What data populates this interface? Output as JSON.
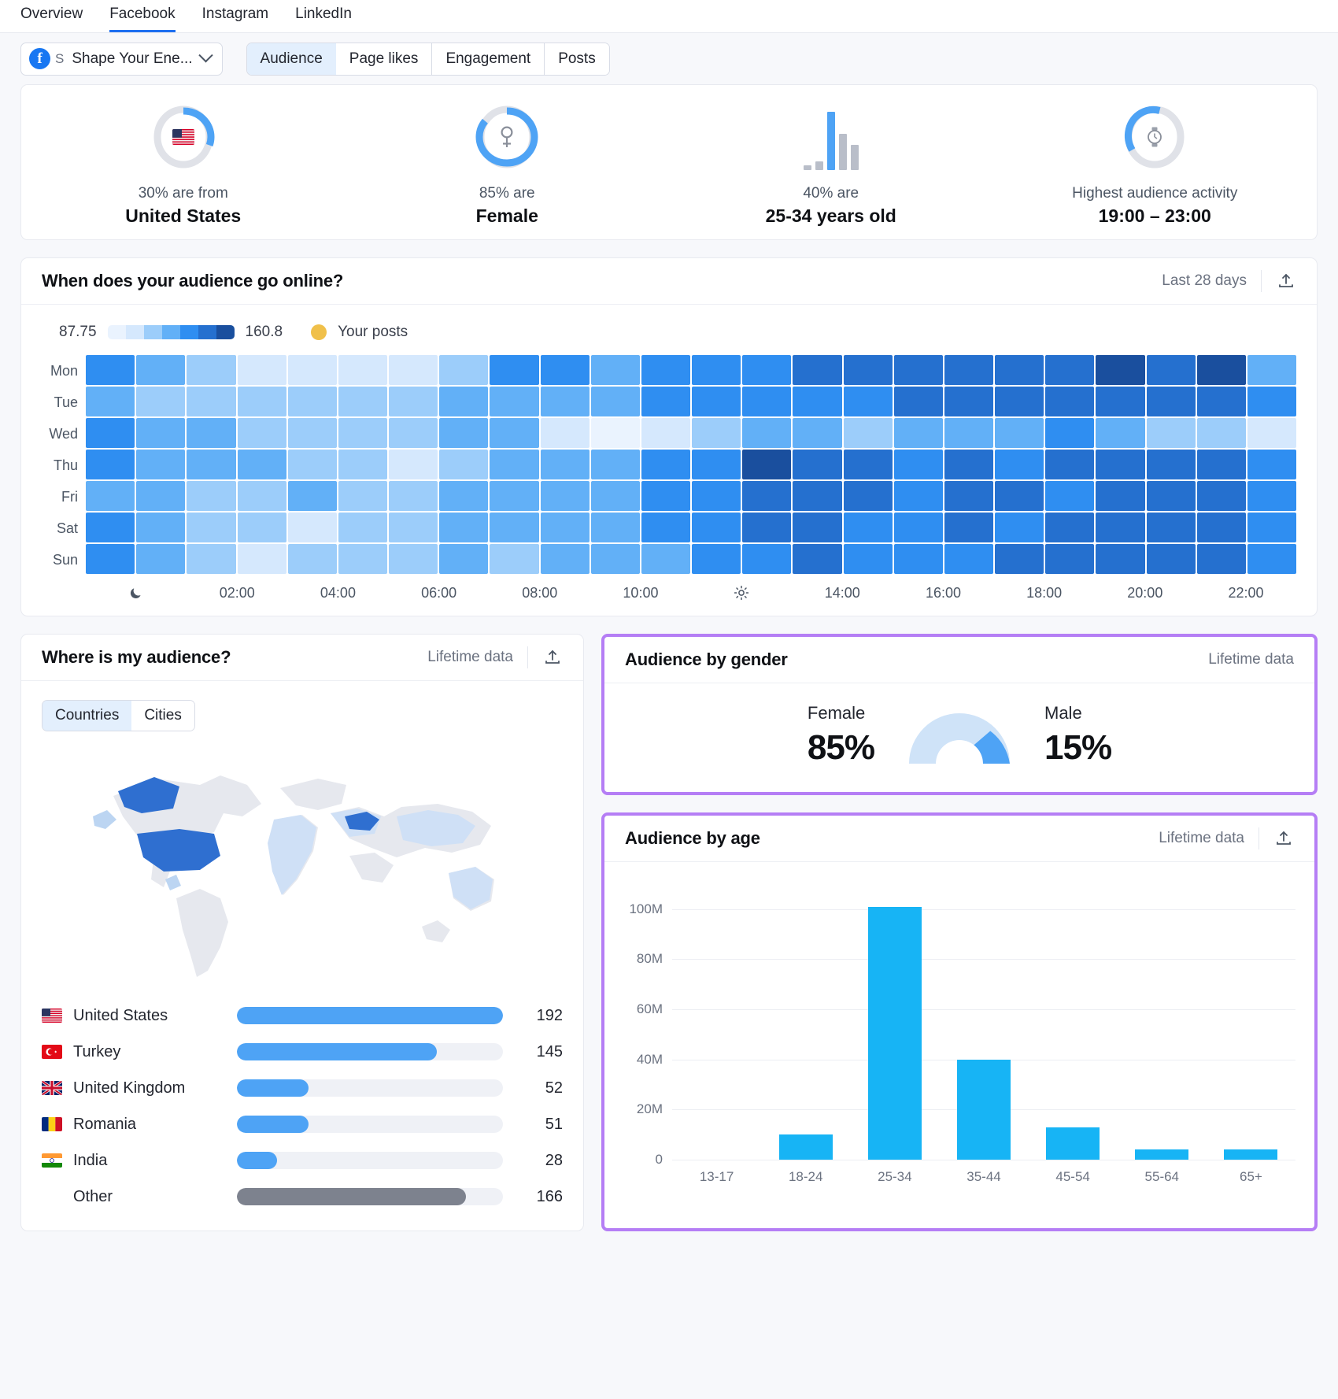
{
  "topnav": {
    "items": [
      {
        "label": "Overview",
        "active": false
      },
      {
        "label": "Facebook",
        "active": true
      },
      {
        "label": "Instagram",
        "active": false
      },
      {
        "label": "LinkedIn",
        "active": false
      }
    ]
  },
  "controlbar": {
    "account": {
      "badge": "f",
      "sub": "S",
      "name": "Shape Your Ene...",
      "chevron": "chevron-down-icon"
    },
    "tabs": [
      {
        "label": "Audience",
        "active": true
      },
      {
        "label": "Page likes",
        "active": false
      },
      {
        "label": "Engagement",
        "active": false
      },
      {
        "label": "Posts",
        "active": false
      }
    ]
  },
  "kpis": [
    {
      "sub": "30% are from",
      "main": "United States",
      "ring_pct": 30,
      "icon": "us-flag-icon"
    },
    {
      "sub": "85% are",
      "main": "Female",
      "ring_pct": 85,
      "icon": "female-symbol-icon"
    },
    {
      "sub": "40% are",
      "main": "25-34 years old",
      "icon": "bar-chart-icon",
      "mini_bars": [
        6,
        11,
        74,
        46,
        32
      ],
      "mini_highlight": 2
    },
    {
      "sub": "Highest audience activity",
      "main": "19:00 – 23:00",
      "ring_pct": 36,
      "icon": "clock-icon"
    }
  ],
  "heatmap": {
    "title": "When does your audience go online?",
    "period": "Last 28 days",
    "export_icon": "export-icon",
    "legend": {
      "min": "87.75",
      "max": "160.8",
      "marker_label": "Your posts",
      "marker_color": "#f0c04a",
      "scale": [
        "#eaf3fe",
        "#d5e8fd",
        "#9ccdfa",
        "#62b0f7",
        "#2f8ef1",
        "#2570cf",
        "#1a4f9e"
      ]
    },
    "days": [
      "Mon",
      "Tue",
      "Wed",
      "Thu",
      "Fri",
      "Sat",
      "Sun"
    ],
    "x_labels": [
      "moon-icon",
      "02:00",
      "04:00",
      "06:00",
      "08:00",
      "10:00",
      "sun-icon",
      "14:00",
      "16:00",
      "18:00",
      "20:00",
      "22:00"
    ],
    "values": {
      "Mon": [
        135,
        124,
        110,
        99,
        101,
        104,
        106,
        118,
        131,
        132,
        129,
        133,
        140,
        137,
        146,
        145,
        151,
        148,
        152,
        150,
        155,
        153,
        156,
        122
      ],
      "Tue": [
        125,
        112,
        110,
        113,
        114,
        116,
        118,
        122,
        130,
        128,
        120,
        133,
        136,
        134,
        138,
        141,
        152,
        144,
        150,
        147,
        154,
        149,
        151,
        139
      ],
      "Wed": [
        134,
        121,
        125,
        112,
        113,
        115,
        117,
        119,
        127,
        95,
        90,
        105,
        113,
        121,
        123,
        118,
        126,
        124,
        129,
        132,
        121,
        117,
        110,
        106
      ],
      "Thu": [
        136,
        122,
        124,
        127,
        115,
        117,
        103,
        113,
        121,
        124,
        128,
        131,
        139,
        155,
        151,
        146,
        140,
        144,
        142,
        147,
        145,
        150,
        143,
        138
      ],
      "Fri": [
        126,
        128,
        117,
        116,
        119,
        112,
        110,
        122,
        124,
        127,
        129,
        134,
        138,
        149,
        152,
        150,
        140,
        147,
        144,
        142,
        148,
        146,
        143,
        141
      ],
      "Sat": [
        137,
        123,
        114,
        116,
        103,
        108,
        112,
        121,
        125,
        129,
        124,
        131,
        133,
        148,
        146,
        142,
        138,
        145,
        140,
        143,
        150,
        147,
        144,
        136
      ],
      "Sun": [
        138,
        126,
        113,
        104,
        107,
        111,
        115,
        120,
        118,
        127,
        122,
        129,
        135,
        142,
        147,
        141,
        137,
        139,
        144,
        149,
        152,
        148,
        146,
        134
      ]
    },
    "scale_min": 87.75,
    "scale_max": 160.8
  },
  "geo": {
    "title": "Where is my audience?",
    "period": "Lifetime data",
    "export_icon": "export-icon",
    "tabs": [
      {
        "label": "Countries",
        "active": true
      },
      {
        "label": "Cities",
        "active": false
      }
    ],
    "map_icon": "world-map-icon",
    "rows": [
      {
        "flag": "us-flag-icon",
        "name": "United States",
        "value": "192",
        "pct": 100,
        "grey": false
      },
      {
        "flag": "tr-flag-icon",
        "name": "Turkey",
        "value": "145",
        "pct": 75,
        "grey": false
      },
      {
        "flag": "gb-flag-icon",
        "name": "United Kingdom",
        "value": "52",
        "pct": 27,
        "grey": false
      },
      {
        "flag": "ro-flag-icon",
        "name": "Romania",
        "value": "51",
        "pct": 27,
        "grey": false
      },
      {
        "flag": "in-flag-icon",
        "name": "India",
        "value": "28",
        "pct": 15,
        "grey": false
      },
      {
        "flag": "",
        "name": "Other",
        "value": "166",
        "pct": 86,
        "grey": true
      }
    ]
  },
  "gender": {
    "title": "Audience by gender",
    "period": "Lifetime data",
    "female_label": "Female",
    "female_pct": "85%",
    "male_label": "Male",
    "male_pct": "15%",
    "female_color": "#cfe3f8",
    "male_color": "#4ea3f5"
  },
  "chart_data": {
    "type": "bar",
    "title": "Audience by age",
    "period": "Lifetime data",
    "export_icon": "export-icon",
    "categories": [
      "13-17",
      "18-24",
      "25-34",
      "35-44",
      "45-54",
      "55-64",
      "65+"
    ],
    "values": [
      0,
      10000000,
      101000000,
      40000000,
      13000000,
      4000000,
      4000000
    ],
    "ytick_labels": [
      "0",
      "20M",
      "40M",
      "60M",
      "80M",
      "100M"
    ],
    "ytick_values": [
      0,
      20000000,
      40000000,
      60000000,
      80000000,
      100000000
    ],
    "ylim": [
      0,
      110000000
    ],
    "xlabel": "",
    "ylabel": "",
    "grid": true,
    "legend": "none",
    "bar_color": "#17b4f5"
  }
}
